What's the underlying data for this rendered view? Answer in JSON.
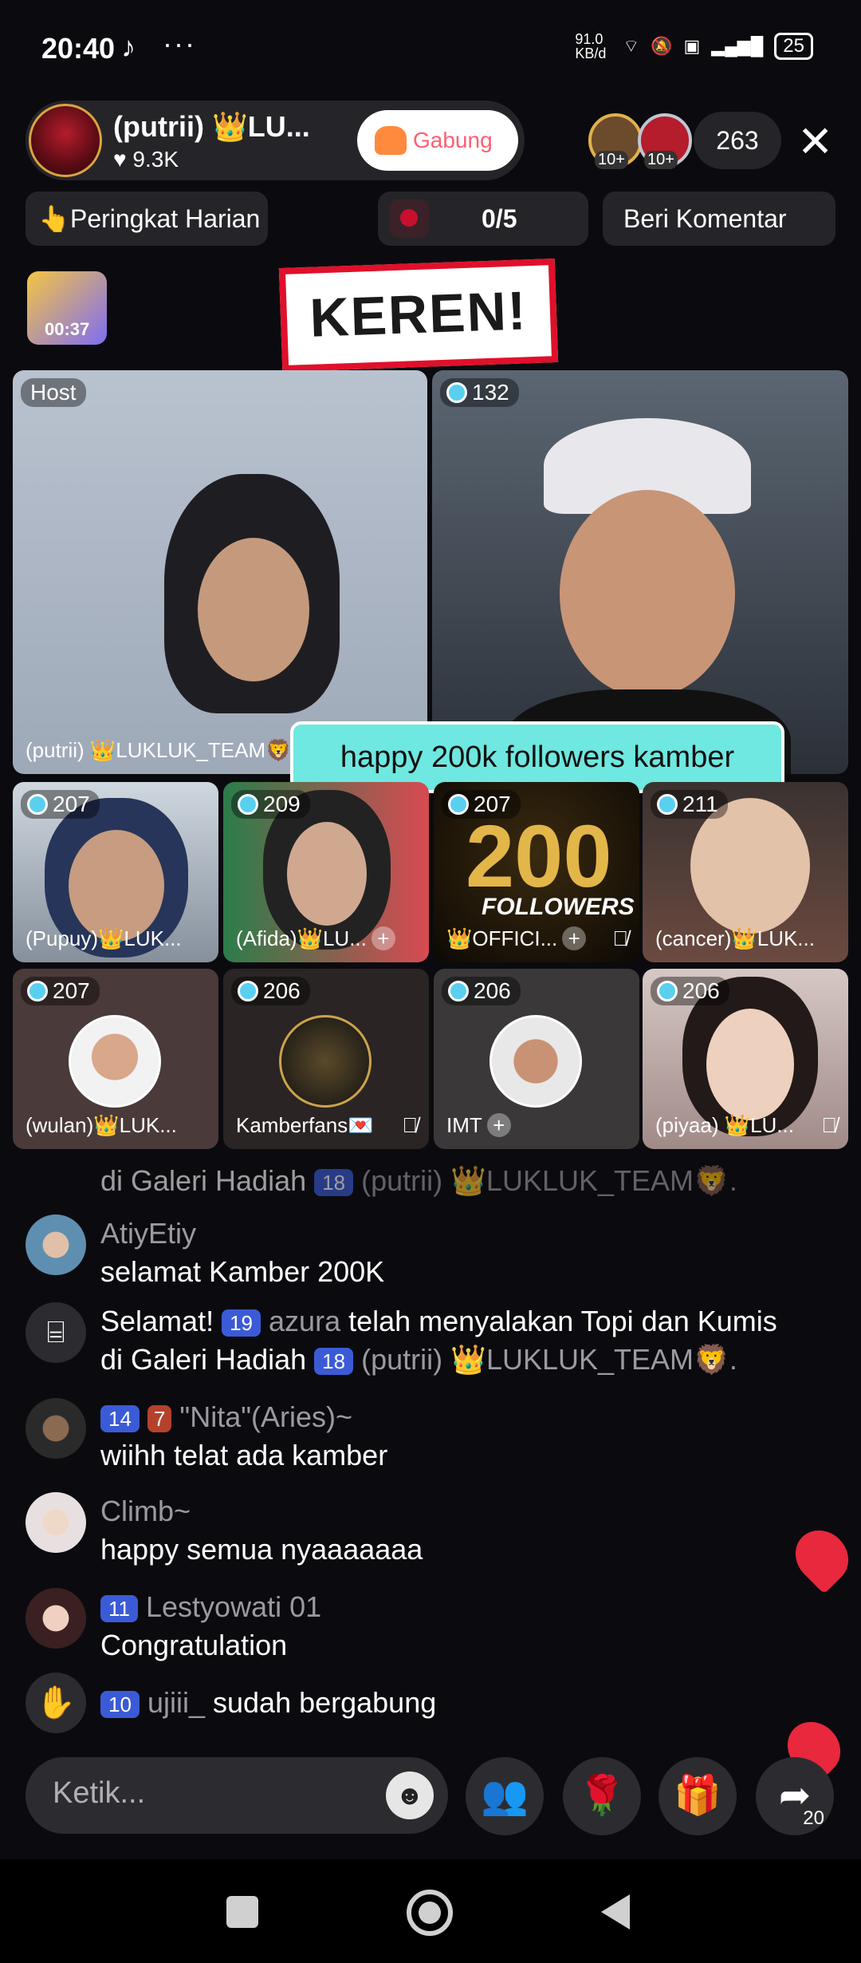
{
  "status_bar": {
    "time": "20:40",
    "app_icon": "tiktok-icon",
    "more": "···",
    "net_speed": "91.0 KB/d",
    "battery": "25"
  },
  "host": {
    "name": "(putrii) 👑LU...",
    "likes": "♥ 9.3K",
    "join_label": "Gabung",
    "viewer_badges": [
      "10+",
      "10+"
    ],
    "viewer_count": "263"
  },
  "top_row": {
    "ranking_label": "Peringkat Harian",
    "goal_label": "0/5",
    "comment_label": "Beri Komentar"
  },
  "timer": "00:37",
  "reaction": "KEREN!",
  "stage": {
    "host_tag": "Host",
    "host_name": "(putrii) 👑LUKLUK_TEAM🦁",
    "guest_score": "132",
    "banner": "happy 200k followers kamber"
  },
  "guests": [
    {
      "score": "207",
      "name": "(Pupuy)👑LUK..."
    },
    {
      "score": "209",
      "name": "(Afida)👑LU..."
    },
    {
      "score": "207",
      "name": "👑OFFICI..."
    },
    {
      "score": "211",
      "name": "(cancer)👑LUK..."
    },
    {
      "score": "207",
      "name": "(wulan)👑LUK..."
    },
    {
      "score": "206",
      "name": "Kamberfans💌"
    },
    {
      "score": "206",
      "name": "IMT"
    },
    {
      "score": "206",
      "name": "(piyaa) 👑LU..."
    }
  ],
  "tile3_overlay": {
    "big": "200",
    "sub": "FOLLOWERS"
  },
  "chat": [
    {
      "text": "di Galeri Hadiah",
      "badge": "18",
      "user": "(putrii) 👑LUKLUK_TEAM🦁."
    },
    {
      "user": "AtiyEtiy",
      "text": "selamat Kamber 200K"
    },
    {
      "line1_a": "Selamat!",
      "badge1": "19",
      "user": "azura",
      "line1_b": "telah menyalakan Topi dan Kumis",
      "line2_a": "di Galeri Hadiah",
      "badge2": "18",
      "user2": "(putrii)",
      "tail": "👑LUKLUK_TEAM🦁."
    },
    {
      "badge": "14",
      "badge_b": "7",
      "user": "\"Nita\"(Aries)~",
      "text": "wiihh telat ada kamber"
    },
    {
      "user": "Climb~",
      "text": "happy semua nyaaaaaaa"
    },
    {
      "badge": "11",
      "user": "Lestyowati 01",
      "text": "Congratulation"
    },
    {
      "badge": "10",
      "user": "ujiii_",
      "text": "sudah bergabung"
    }
  ],
  "input": {
    "placeholder": "Ketik..."
  },
  "share_count": "20",
  "colors": {
    "accent": "#6ee8e0",
    "badge_blue": "#3b5bd6",
    "heart": "#e8283c",
    "join": "#ff5f73"
  }
}
